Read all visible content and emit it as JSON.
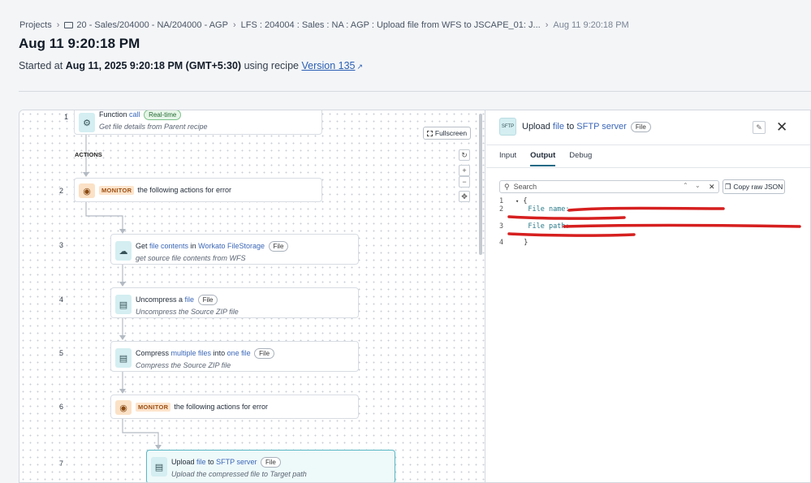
{
  "breadcrumb": {
    "projects": "Projects",
    "folder": "20 - Sales/204000 - NA/204000 - AGP",
    "recipe": "LFS : 204004 : Sales : NA : AGP : Upload file from WFS to JSCAPE_01: J...",
    "timestamp": "Aug 11 9:20:18 PM"
  },
  "title": "Aug 11 9:20:18 PM",
  "subtitle": {
    "prefix": "Started at",
    "datetime": "Aug 11, 2025 9:20:18 PM (GMT+5:30)",
    "middle": "using recipe",
    "version": "Version 135"
  },
  "canvas": {
    "fullscreen": "Fullscreen",
    "actions_label": "ACTIONS",
    "steps": [
      {
        "num": "1",
        "word": "Function",
        "link": "call",
        "pill": "Real-time",
        "desc": "Get file details from Parent recipe"
      },
      {
        "num": "2",
        "tag": "MONITOR",
        "text": "the following actions for error"
      },
      {
        "num": "3",
        "pre": "Get",
        "link1": "file contents",
        "mid": "in",
        "link2": "Workato FileStorage",
        "pill": "File",
        "desc": "get source file contents from WFS"
      },
      {
        "num": "4",
        "pre": "Uncompress a",
        "link1": "file",
        "pill": "File",
        "desc": "Uncompress the Source ZIP file"
      },
      {
        "num": "5",
        "pre": "Compress",
        "link1": "multiple files",
        "mid": "into",
        "link2": "one file",
        "pill": "File",
        "desc": "Compress the Source ZIP file"
      },
      {
        "num": "6",
        "tag": "MONITOR",
        "text": "the following actions for error"
      },
      {
        "num": "7",
        "pre": "Upload",
        "link1": "file",
        "mid": "to",
        "link2": "SFTP server",
        "pill": "File",
        "desc": "Upload the compressed file to Target path"
      }
    ]
  },
  "side": {
    "pre": "Upload",
    "link1": "file",
    "mid": "to",
    "link2": "SFTP server",
    "pill": "File",
    "tabs": [
      "Input",
      "Output",
      "Debug"
    ],
    "search_placeholder": "Search",
    "copy_label": "Copy raw JSON",
    "code": {
      "l1": "{",
      "k2": "File name:",
      "k3": "File path:",
      "l4": "}",
      "n1": "1",
      "n2": "2",
      "n3": "3",
      "n4": "4"
    }
  },
  "colors": {
    "accent": "#1f6b86",
    "link": "#3b67b8",
    "selected_border": "#58b8c4",
    "redaction": "#d61f1f"
  }
}
